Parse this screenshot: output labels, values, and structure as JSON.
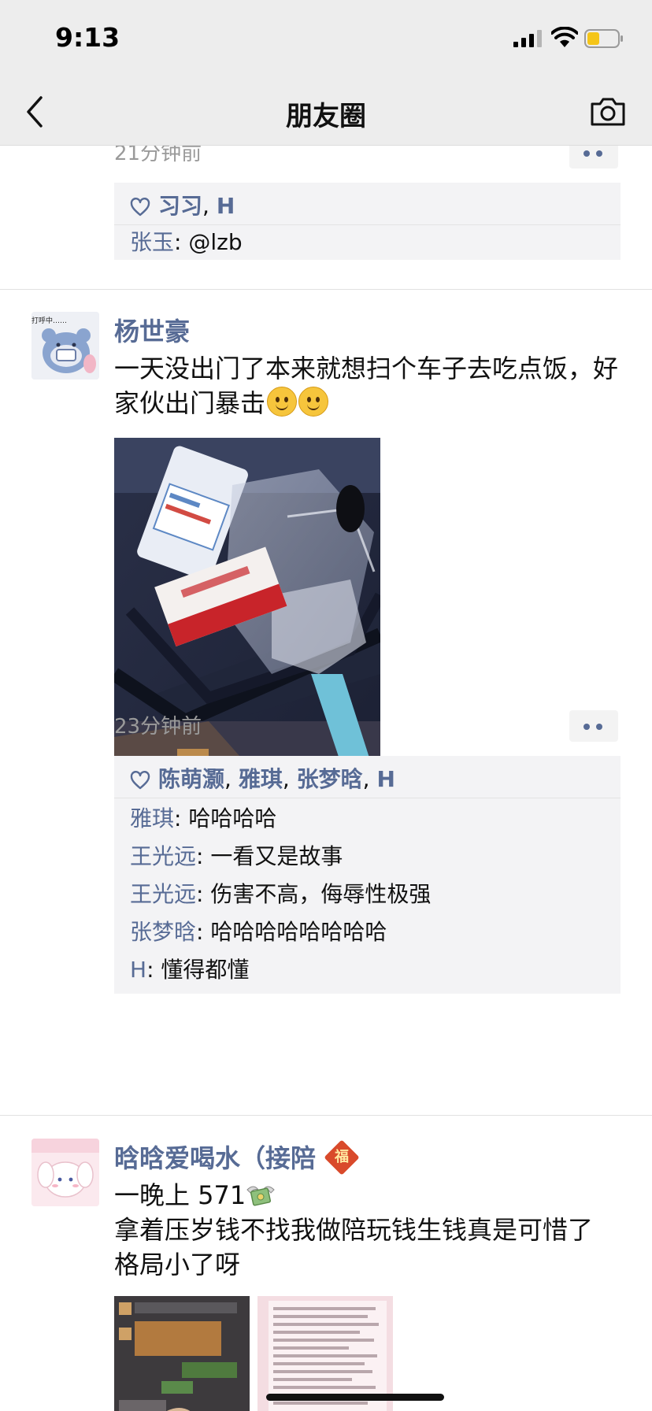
{
  "status_bar": {
    "time": "9:13"
  },
  "nav": {
    "title": "朋友圈"
  },
  "post_top": {
    "timestamp": "21分钟前",
    "likes": [
      "习习",
      "H"
    ],
    "comments": [
      {
        "author": "张玉",
        "text": "@lzb"
      }
    ]
  },
  "post_yang": {
    "author": "杨世豪",
    "avatar_caption": "打呼中……",
    "text": "一天没出门了本来就想扫个车子去吃点饭，好家伙出门暴击",
    "timestamp": "23分钟前",
    "likes": [
      "陈萌灏",
      "雅琪",
      "张梦晗",
      "H"
    ],
    "comments": [
      {
        "author": "雅琪",
        "text": "哈哈哈哈"
      },
      {
        "author": "王光远",
        "text": "一看又是故事"
      },
      {
        "author": "王光远",
        "text": "伤害不高，侮辱性极强"
      },
      {
        "author": "张梦晗",
        "text": "哈哈哈哈哈哈哈哈"
      },
      {
        "author": "H",
        "text": "懂得都懂"
      }
    ]
  },
  "post_han": {
    "author": "晗晗爱喝水（接陪",
    "badge": "福",
    "text_line1": "一晚上 571",
    "text_line2": "拿着压岁钱不找我做陪玩钱生钱真是可惜了 格局小了呀"
  },
  "colors": {
    "link": "#576b95",
    "bar_bg": "#ededed",
    "comment_bg": "#f3f3f5",
    "timestamp": "#9a9a9a"
  }
}
